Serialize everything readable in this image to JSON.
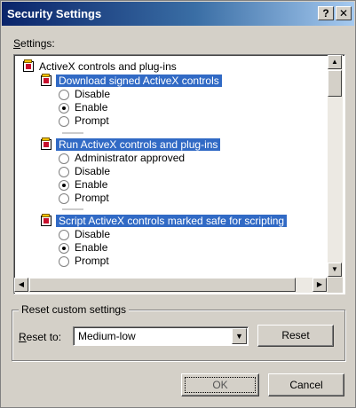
{
  "window": {
    "title": "Security Settings",
    "help_label": "?",
    "close_label": "✕"
  },
  "settings_label_prefix": "S",
  "settings_label_rest": "ettings:",
  "list": {
    "category_title": "ActiveX controls and plug-ins",
    "groups": [
      {
        "heading": "Download signed ActiveX controls",
        "options": [
          {
            "label": "Disable",
            "checked": false
          },
          {
            "label": "Enable",
            "checked": true
          },
          {
            "label": "Prompt",
            "checked": false
          }
        ]
      },
      {
        "heading": "Run ActiveX controls and plug-ins",
        "options": [
          {
            "label": "Administrator approved",
            "checked": false
          },
          {
            "label": "Disable",
            "checked": false
          },
          {
            "label": "Enable",
            "checked": true
          },
          {
            "label": "Prompt",
            "checked": false
          }
        ]
      },
      {
        "heading": "Script ActiveX controls marked safe for scripting",
        "options": [
          {
            "label": "Disable",
            "checked": false
          },
          {
            "label": "Enable",
            "checked": true
          },
          {
            "label": "Prompt",
            "checked": false
          }
        ]
      }
    ]
  },
  "reset_group": {
    "title": "Reset custom settings",
    "reset_to_prefix": "R",
    "reset_to_rest": "eset to:",
    "selected_level": "Medium-low",
    "reset_button": "Reset"
  },
  "footer": {
    "ok_label": "OK",
    "cancel_label": "Cancel"
  }
}
